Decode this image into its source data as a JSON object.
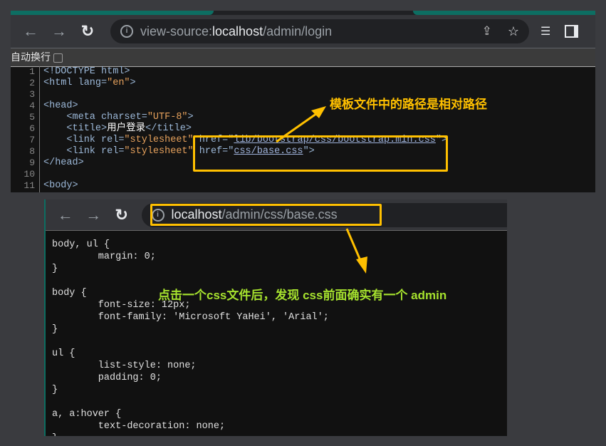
{
  "window1": {
    "url_prefix": "view-source:",
    "url_host": "localhost",
    "url_path": "/admin/login",
    "wrap_label": "自动换行",
    "line_numbers": [
      "1",
      "2",
      "3",
      "4",
      "5",
      "6",
      "7",
      "8",
      "9",
      "10",
      "11"
    ]
  },
  "window2": {
    "url_host": "localhost",
    "url_path": "/admin/css/base.css"
  },
  "annotations": {
    "top": "模板文件中的路径是相对路径",
    "bottom": "点击一个css文件后，发现 css前面确实有一个 admin",
    "top_color": "#ffc000",
    "bottom_color": "#a6e22e"
  },
  "css_source": [
    "body, ul {",
    "        margin: 0;",
    "}",
    "",
    "body {",
    "        font-size: 12px;",
    "        font-family: 'Microsoft YaHei', 'Arial';",
    "}",
    "",
    "ul {",
    "        list-style: none;",
    "        padding: 0;",
    "}",
    "",
    "a, a:hover {",
    "        text-decoration: none;",
    "}"
  ],
  "html_source": {
    "l1": "<!DOCTYPE html>",
    "l2a": "<html lang=",
    "l2b": "\"en\"",
    "l2c": ">",
    "l4": "<head>",
    "l5a": "    <meta charset=",
    "l5b": "\"UTF-8\"",
    "l5c": ">",
    "l6a": "    <title>",
    "l6b": "用户登录",
    "l6c": "</title>",
    "l7a": "    <link rel=",
    "l7b": "\"stylesheet\"",
    "l7c": " href=\"",
    "l7d": "lib/bootstrap/css/bootstrap.min.css",
    "l7e": "\">",
    "l8a": "    <link rel=",
    "l8b": "\"stylesheet\"",
    "l8c": " href=\"",
    "l8d": "css/base.css",
    "l8e": "\">",
    "l9": "</head>",
    "l11": "<body>"
  }
}
